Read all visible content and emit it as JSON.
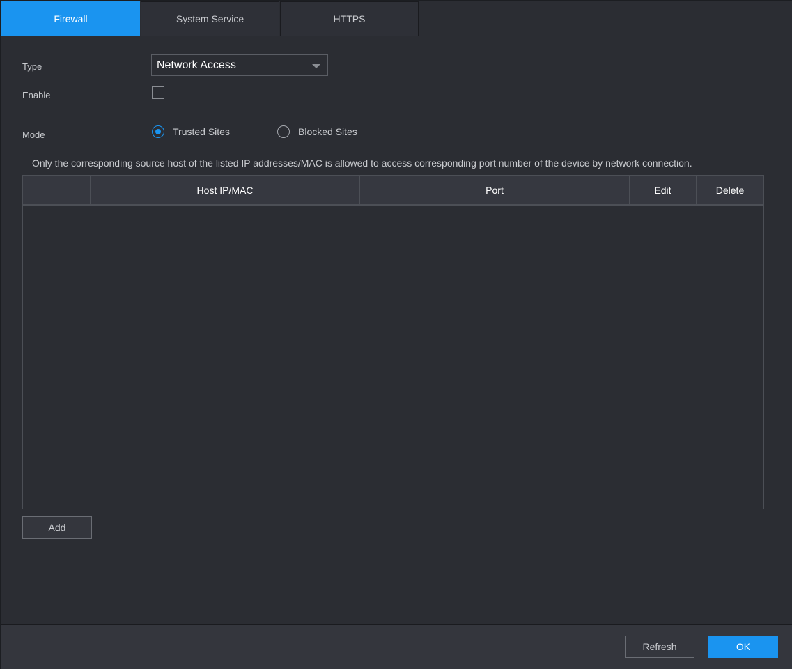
{
  "tabs": [
    {
      "label": "Firewall",
      "active": true
    },
    {
      "label": "System Service",
      "active": false
    },
    {
      "label": "HTTPS",
      "active": false
    }
  ],
  "form": {
    "type_label": "Type",
    "type_value": "Network Access",
    "enable_label": "Enable",
    "enable_checked": false,
    "mode_label": "Mode",
    "mode_options": [
      {
        "label": "Trusted Sites",
        "checked": true
      },
      {
        "label": "Blocked Sites",
        "checked": false
      }
    ],
    "hint": "Only the corresponding source host of the listed IP addresses/MAC is allowed to access corresponding port number of the device by network connection."
  },
  "table": {
    "columns": [
      "",
      "Host IP/MAC",
      "Port",
      "Edit",
      "Delete"
    ],
    "rows": []
  },
  "buttons": {
    "add": "Add",
    "refresh": "Refresh",
    "ok": "OK"
  },
  "colors": {
    "accent": "#1a94f0",
    "background": "#2b2d33"
  }
}
